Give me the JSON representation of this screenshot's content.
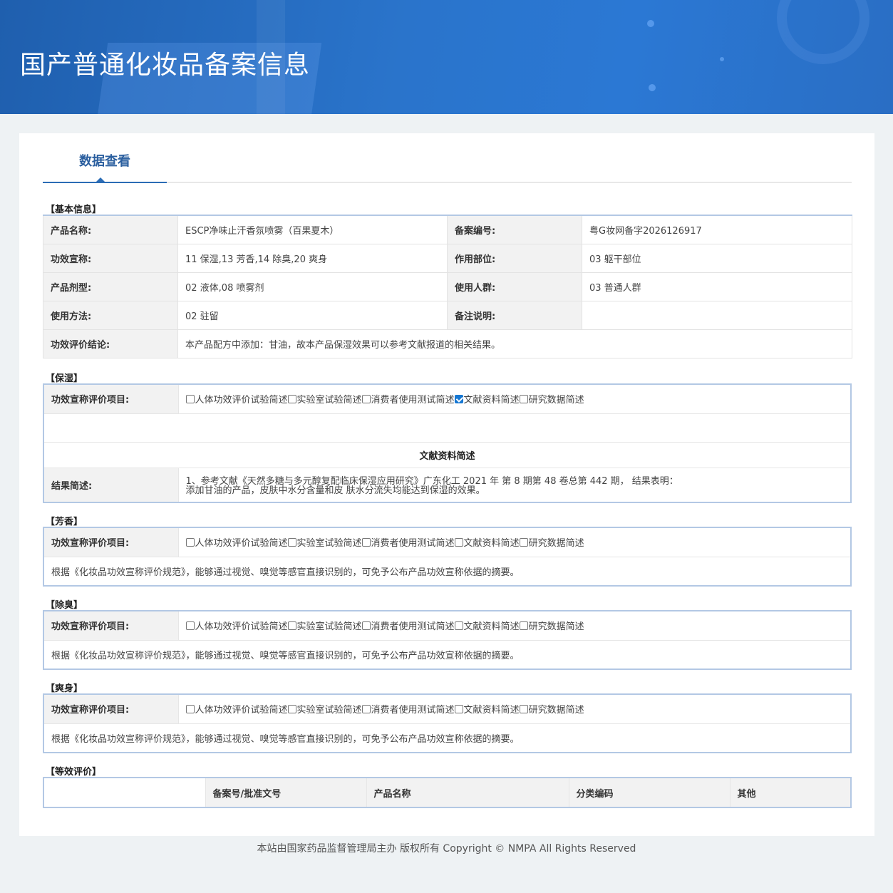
{
  "banner": {
    "title": "国产普通化妆品备案信息"
  },
  "tab": {
    "label": "数据查看"
  },
  "basic": {
    "title": "【基本信息】",
    "rows": [
      {
        "l1": "产品名称:",
        "v1": "ESCP净味止汗香氛喷雾（百果夏木）",
        "l2": "备案编号:",
        "v2": "粤G妆网备字2026126917"
      },
      {
        "l1": "功效宣称:",
        "v1": "11 保湿,13 芳香,14 除臭,20 爽身",
        "l2": "作用部位:",
        "v2": "03 躯干部位"
      },
      {
        "l1": "产品剂型:",
        "v1": "02 液体,08 喷雾剂",
        "l2": "使用人群:",
        "v2": "03 普通人群"
      },
      {
        "l1": "使用方法:",
        "v1": "02 驻留",
        "l2": "备注说明:",
        "v2": ""
      }
    ],
    "conclusion_label": "功效评价结论:",
    "conclusion": "本产品配方中添加：甘油，故本产品保湿效果可以参考文献报道的相关结果。"
  },
  "checkbox_options": [
    "人体功效评价试验简述",
    "实验室试验简述",
    "消费者使用测试简述",
    "文献资料简述",
    "研究数据简述"
  ],
  "item_label": "功效宣称评价项目:",
  "baoshi": {
    "title": "【保湿】",
    "checked": [
      false,
      false,
      false,
      true,
      false
    ],
    "subheader": "文献资料简述",
    "result_label": "结果简述:",
    "result_line1": "1、参考文献《天然多糖与多元醇复配临床保湿应用研究》广东化工 2021 年 第 8 期第 48 卷总第 442 期， 结果表明：",
    "result_line2": "添加甘油的产品，皮肤中水分含量和皮 肤水分流失均能达到保湿的效果。"
  },
  "fangxiang": {
    "title": "【芳香】",
    "checked": [
      false,
      false,
      false,
      false,
      false
    ],
    "note": "根据《化妆品功效宣称评价规范》，能够通过视觉、嗅觉等感官直接识别的，可免予公布产品功效宣称依据的摘要。"
  },
  "chuchou": {
    "title": "【除臭】",
    "checked": [
      false,
      false,
      false,
      false,
      false
    ],
    "note": "根据《化妆品功效宣称评价规范》，能够通过视觉、嗅觉等感官直接识别的，可免予公布产品功效宣称依据的摘要。"
  },
  "shuangshen": {
    "title": "【爽身】",
    "checked": [
      false,
      false,
      false,
      false,
      false
    ],
    "note": "根据《化妆品功效宣称评价规范》，能够通过视觉、嗅觉等感官直接识别的，可免予公布产品功效宣称依据的摘要。"
  },
  "dengxiao": {
    "title": "【等效评价】",
    "headers": [
      "",
      "备案号/批准文号",
      "产品名称",
      "分类编码",
      "其他"
    ]
  },
  "footer": {
    "text": "本站由国家药品监督管理局主办 版权所有 Copyright © NMPA All Rights Reserved"
  }
}
